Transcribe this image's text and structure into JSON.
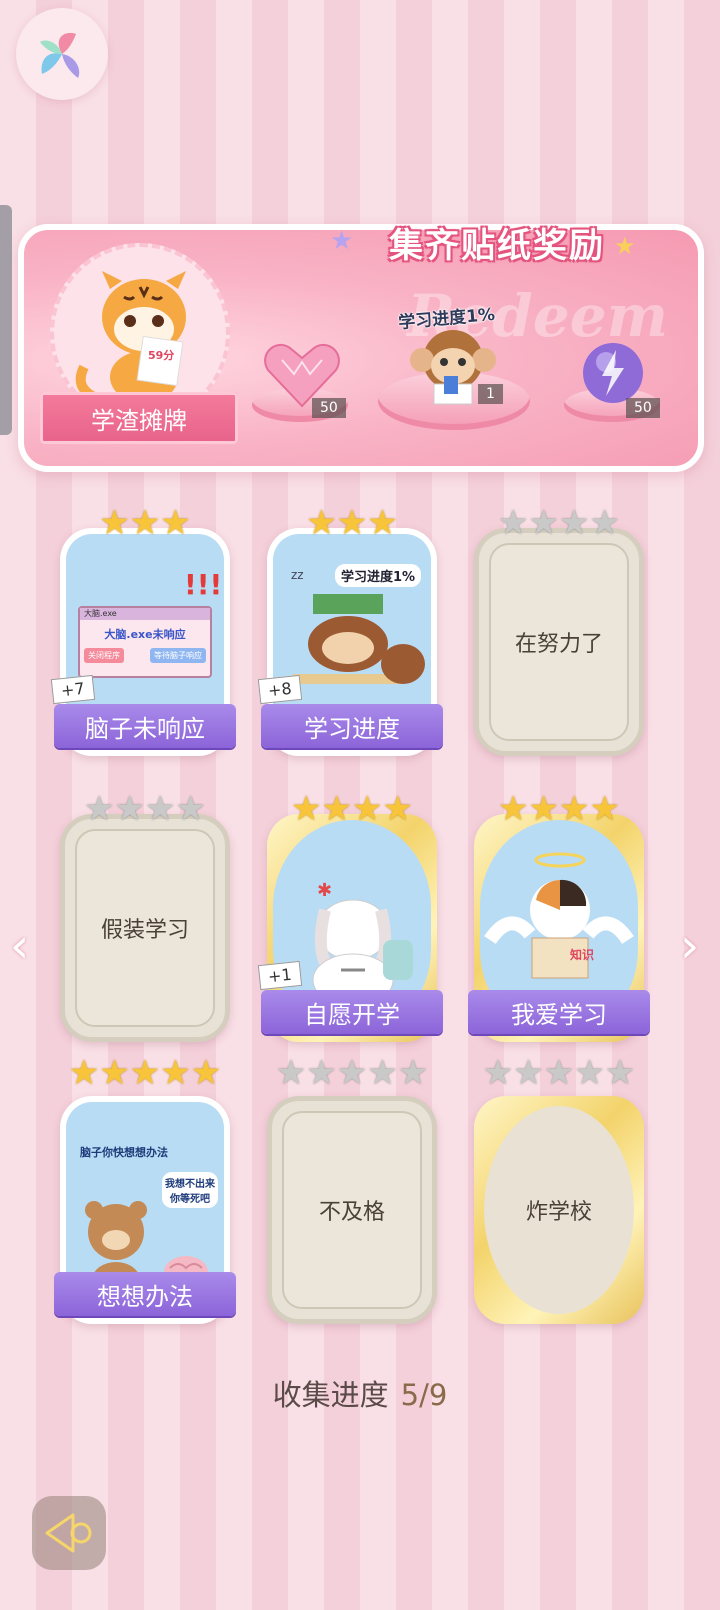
{
  "banner": {
    "title": "集齐贴纸奖励",
    "watermark": "Redeem",
    "ribbon_label": "学渣摊牌",
    "tiger_score": "59分",
    "progress_tag": "学习进度1%",
    "rewards": [
      {
        "name": "heart-gem",
        "count": "50"
      },
      {
        "name": "monkey-sticker",
        "count": "1"
      },
      {
        "name": "lightning-orb",
        "count": "50"
      }
    ]
  },
  "cards": [
    {
      "label": "脑子未响应",
      "stars": 3,
      "star_color": "gold",
      "plus": "+7",
      "state": "unlocked",
      "art": {
        "title": "大脑.exe",
        "text": "大脑.exe未响应",
        "btn1": "关闭程序",
        "btn2": "等待脑子响应"
      }
    },
    {
      "label": "学习进度",
      "stars": 3,
      "star_color": "gold",
      "plus": "+8",
      "state": "unlocked",
      "art": {
        "text": "学习进度1%"
      }
    },
    {
      "label": "在努力了",
      "stars": 4,
      "star_color": "grey",
      "plus": "",
      "state": "locked"
    },
    {
      "label": "假装学习",
      "stars": 4,
      "star_color": "grey",
      "plus": "",
      "state": "locked"
    },
    {
      "label": "自愿开学",
      "stars": 4,
      "star_color": "gold",
      "plus": "+1",
      "state": "unlocked-gold"
    },
    {
      "label": "我爱学习",
      "stars": 4,
      "star_color": "gold",
      "plus": "",
      "state": "unlocked-gold",
      "art": {
        "book_text": "知识"
      }
    },
    {
      "label": "想想办法",
      "stars": 5,
      "star_color": "gold",
      "plus": "",
      "state": "unlocked",
      "art": {
        "text1": "脑子你快想想办法",
        "text2": "我想不出来你等死吧"
      }
    },
    {
      "label": "不及格",
      "stars": 5,
      "star_color": "grey",
      "plus": "",
      "state": "locked"
    },
    {
      "label": "炸学校",
      "stars": 5,
      "star_color": "grey",
      "plus": "",
      "state": "locked-gold"
    }
  ],
  "collection": {
    "label": "收集进度",
    "value": "5/9"
  }
}
